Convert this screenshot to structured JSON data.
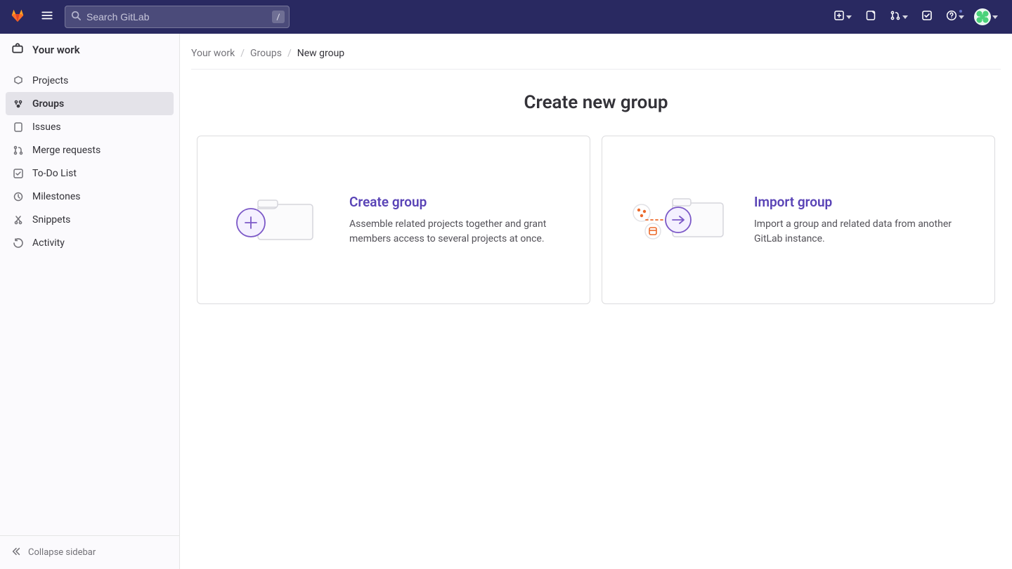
{
  "header": {
    "search_placeholder": "Search GitLab",
    "search_shortcut": "/"
  },
  "sidebar": {
    "title": "Your work",
    "items": [
      {
        "label": "Projects",
        "icon": "project-icon"
      },
      {
        "label": "Groups",
        "icon": "group-icon",
        "active": true
      },
      {
        "label": "Issues",
        "icon": "issues-icon"
      },
      {
        "label": "Merge requests",
        "icon": "merge-request-icon"
      },
      {
        "label": "To-Do List",
        "icon": "todo-icon"
      },
      {
        "label": "Milestones",
        "icon": "milestone-icon"
      },
      {
        "label": "Snippets",
        "icon": "snippets-icon"
      },
      {
        "label": "Activity",
        "icon": "activity-icon"
      }
    ],
    "collapse_label": "Collapse sidebar"
  },
  "breadcrumb": {
    "items": [
      {
        "label": "Your work"
      },
      {
        "label": "Groups"
      },
      {
        "label": "New group",
        "current": true
      }
    ]
  },
  "page": {
    "title": "Create new group",
    "panels": [
      {
        "title": "Create group",
        "desc": "Assemble related projects together and grant members access to several projects at once."
      },
      {
        "title": "Import group",
        "desc": "Import a group and related data from another GitLab instance."
      }
    ]
  }
}
